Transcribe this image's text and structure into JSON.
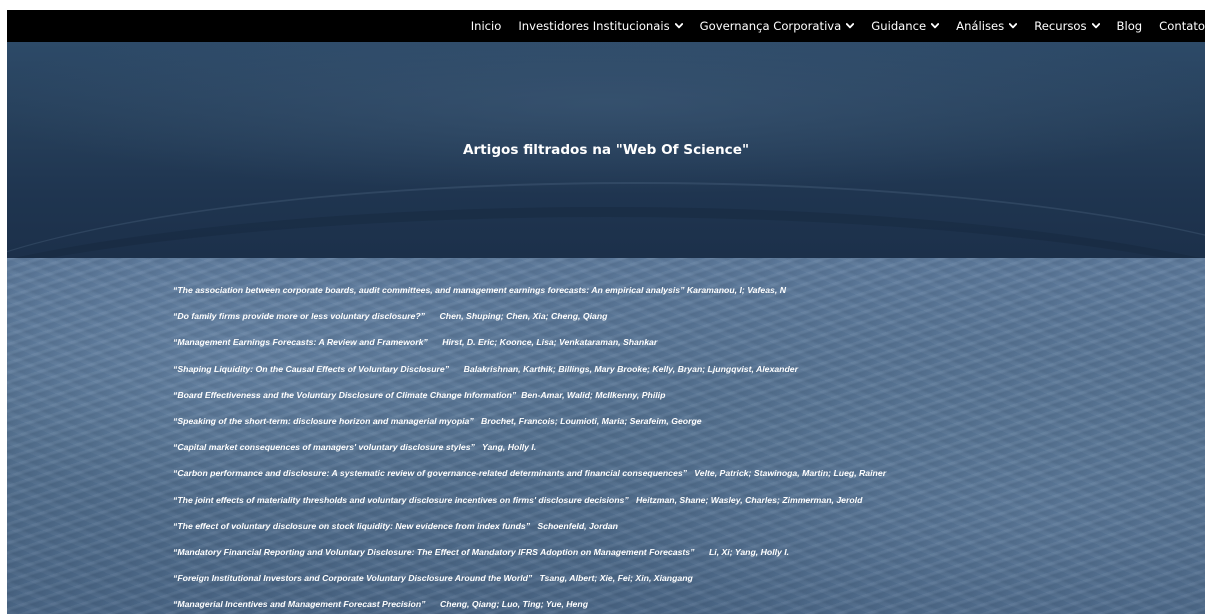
{
  "nav": {
    "items": [
      {
        "label": "Inicio",
        "dropdown": false
      },
      {
        "label": "Investidores Institucionais",
        "dropdown": true
      },
      {
        "label": "Governança Corporativa",
        "dropdown": true
      },
      {
        "label": "Guidance",
        "dropdown": true
      },
      {
        "label": "Análises",
        "dropdown": true
      },
      {
        "label": "Recursos",
        "dropdown": true
      },
      {
        "label": "Blog",
        "dropdown": false
      },
      {
        "label": "Contato",
        "dropdown": false
      }
    ]
  },
  "hero": {
    "title": "Artigos filtrados na \"Web Of Science\""
  },
  "articles": [
    {
      "title": "“The association between corporate boards, audit committees, and management earnings forecasts: An empirical analysis”",
      "sep": " ",
      "authors": "Karamanou, I; Vafeas, N"
    },
    {
      "title": "“Do family firms provide more or less voluntary disclosure?”",
      "sep": "      ",
      "authors": "Chen, Shuping; Chen, Xia; Cheng, Qiang"
    },
    {
      "title": "“Management Earnings Forecasts: A Review and Framework”",
      "sep": "      ",
      "authors": "Hirst, D. Eric; Koonce, Lisa; Venkataraman, Shankar"
    },
    {
      "title": "“Shaping Liquidity: On the Causal Effects of Voluntary Disclosure”",
      "sep": "      ",
      "authors": "Balakrishnan, Karthik; Billings, Mary Brooke; Kelly, Bryan; Ljungqvist, Alexander"
    },
    {
      "title": "“Board Effectiveness and the Voluntary Disclosure of Climate Change Information”",
      "sep": "  ",
      "authors": "Ben-Amar, Walid; McIlkenny, Philip"
    },
    {
      "title": "“Speaking of the short-term: disclosure horizon and managerial myopia”",
      "sep": "   ",
      "authors": "Brochet, Francois; Loumioti, Maria; Serafeim, George"
    },
    {
      "title": "“Capital market consequences of managers' voluntary disclosure styles”",
      "sep": "   ",
      "authors": "Yang, Holly I."
    },
    {
      "title": "“Carbon performance and disclosure: A systematic review of governance-related determinants and financial consequences”",
      "sep": "   ",
      "authors": "Velte, Patrick; Stawinoga, Martin; Lueg, Rainer"
    },
    {
      "title": "“The joint effects of materiality thresholds and voluntary disclosure incentives on firms' disclosure decisions”",
      "sep": "   ",
      "authors": "Heitzman, Shane; Wasley, Charles; Zimmerman, Jerold"
    },
    {
      "title": "“The effect of voluntary disclosure on stock liquidity: New evidence from index funds”",
      "sep": "   ",
      "authors": "Schoenfeld, Jordan"
    },
    {
      "title": "“Mandatory Financial Reporting and Voluntary Disclosure: The Effect of Mandatory IFRS Adoption on Management Forecasts”",
      "sep": "      ",
      "authors": "Li, Xi; Yang, Holly I."
    },
    {
      "title": "“Foreign Institutional Investors and Corporate Voluntary Disclosure Around the World”",
      "sep": "   ",
      "authors": "Tsang, Albert; Xie, Fei; Xin, Xiangang"
    },
    {
      "title": "“Managerial Incentives and Management Forecast Precision”",
      "sep": "      ",
      "authors": "Cheng, Qiang; Luo, Ting; Yue, Heng"
    }
  ]
}
